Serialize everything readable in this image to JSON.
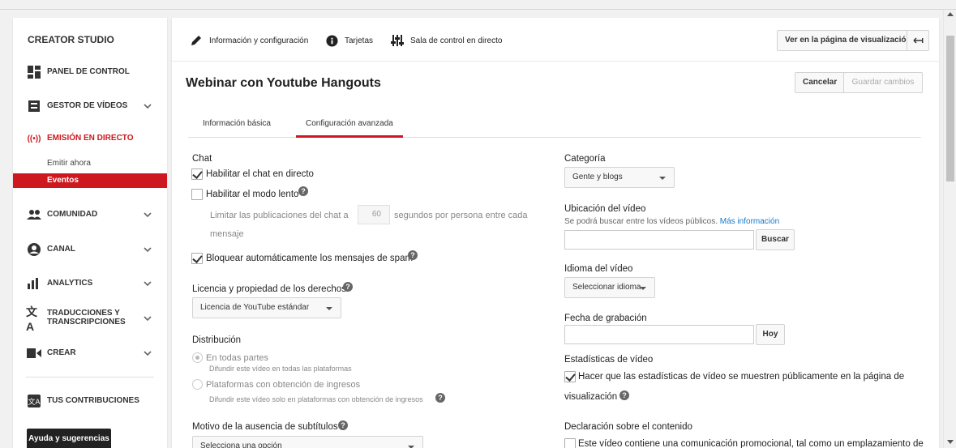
{
  "sidebar": {
    "title": "CREATOR STUDIO",
    "items": [
      {
        "label": "PANEL DE CONTROL",
        "icon": "dashboard-icon"
      },
      {
        "label": "GESTOR DE VÍDEOS",
        "icon": "video-manager-icon"
      },
      {
        "label": "EMISIÓN EN DIRECTO",
        "icon": "live-broadcast-icon"
      },
      {
        "label": "COMUNIDAD",
        "icon": "community-icon"
      },
      {
        "label": "CANAL",
        "icon": "channel-icon"
      },
      {
        "label": "ANALYTICS",
        "icon": "analytics-icon"
      },
      {
        "label_line1": "TRADUCCIONES Y",
        "label_line2": "TRANSCRIPCIONES",
        "icon": "translations-icon"
      },
      {
        "label": "CREAR",
        "icon": "create-icon"
      },
      {
        "label": "TUS CONTRIBUCIONES",
        "icon": "contributions-icon"
      }
    ],
    "live_sub": [
      "Emitir ahora",
      "Eventos"
    ],
    "help_button": "Ayuda y sugerencias"
  },
  "toolbar": {
    "info": "Información y configuración",
    "cards": "Tarjetas",
    "control_room": "Sala de control en directo",
    "view_page": "Ver en la página de visualización"
  },
  "header": {
    "video_title": "Webinar con Youtube Hangouts",
    "cancel": "Cancelar",
    "save": "Guardar cambios"
  },
  "tabs": [
    "Información básica",
    "Configuración avanzada"
  ],
  "left": {
    "chat_heading": "Chat",
    "enable_chat": "Habilitar el chat en directo",
    "slow_mode": "Habilitar el modo lento",
    "limit_pre": "Limitar las publicaciones del chat a",
    "limit_value": "60",
    "limit_post": "segundos por persona entre cada",
    "limit_post2": "mensaje",
    "block_spam": "Bloquear automáticamente los mensajes de spam",
    "license_heading": "Licencia y propiedad de los derechos",
    "license_value": "Licencia de YouTube estándar",
    "distribution_heading": "Distribución",
    "everywhere": "En todas partes",
    "everywhere_desc": "Difundir este vídeo en todas las plataformas",
    "monetized": "Plataformas con obtención de ingresos",
    "monetized_desc": "Difundir este vídeo solo en plataformas con obtención de ingresos",
    "subtitles_heading": "Motivo de la ausencia de subtítulos",
    "subtitles_select": "Selecciona una opción"
  },
  "right": {
    "category_heading": "Categoría",
    "category_value": "Gente y blogs",
    "location_heading": "Ubicación del vídeo",
    "location_desc": "Se podrá buscar entre los vídeos públicos.",
    "location_link": "Más información",
    "search_button": "Buscar",
    "language_heading": "Idioma del vídeo",
    "language_value": "Seleccionar idioma",
    "date_heading": "Fecha de grabación",
    "today_button": "Hoy",
    "stats_heading": "Estadísticas de vídeo",
    "stats_line1": "Hacer que las estadísticas de vídeo se muestren públicamente en la página de",
    "stats_line2": "visualización",
    "declaration_heading": "Declaración sobre el contenido",
    "declaration_text": "Este vídeo contiene una comunicación promocional, tal como un emplazamiento de"
  },
  "colors": {
    "accent": "#cc181e",
    "link": "#167ac6"
  }
}
